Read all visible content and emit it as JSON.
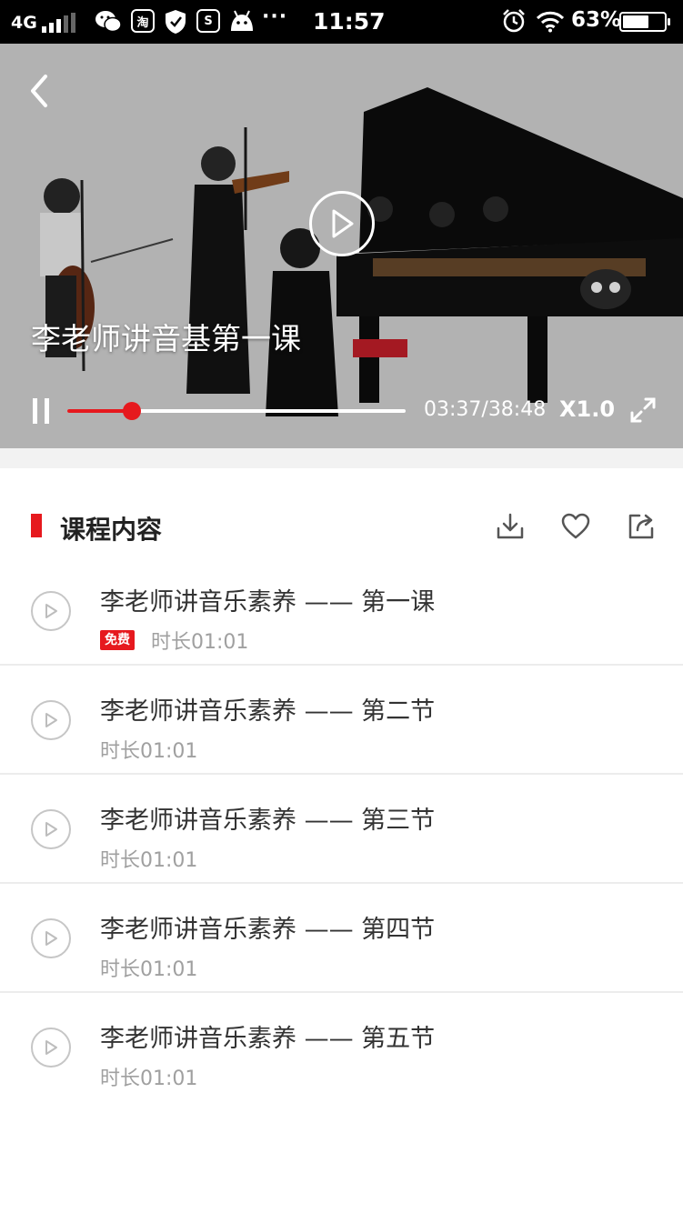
{
  "status_bar": {
    "network": "4G",
    "app_icons": [
      "wechat-icon",
      "taobao-icon",
      "security-icon",
      "screenshot-icon",
      "android-icon"
    ],
    "app_glyphs": [
      "",
      "淘",
      "",
      "S",
      ""
    ],
    "more": "···",
    "time": "11:57",
    "battery_percent": "63%",
    "battery_level": 0.63
  },
  "player": {
    "title": "李老师讲音基第一课",
    "current_time": "03:37",
    "total_time": "38:48",
    "time_display": "03:37/38:48",
    "progress": 0.19,
    "speed": "X1.0"
  },
  "section": {
    "title": "课程内容",
    "accent_color": "#e6191e"
  },
  "lessons": [
    {
      "title": "李老师讲音乐素养 —— 第一课",
      "badge": "免费",
      "duration": "时长01:01"
    },
    {
      "title": "李老师讲音乐素养 —— 第二节",
      "badge": "",
      "duration": "时长01:01"
    },
    {
      "title": "李老师讲音乐素养 —— 第三节",
      "badge": "",
      "duration": "时长01:01"
    },
    {
      "title": "李老师讲音乐素养 —— 第四节",
      "badge": "",
      "duration": "时长01:01"
    },
    {
      "title": "李老师讲音乐素养 —— 第五节",
      "badge": "",
      "duration": "时长01:01"
    }
  ]
}
